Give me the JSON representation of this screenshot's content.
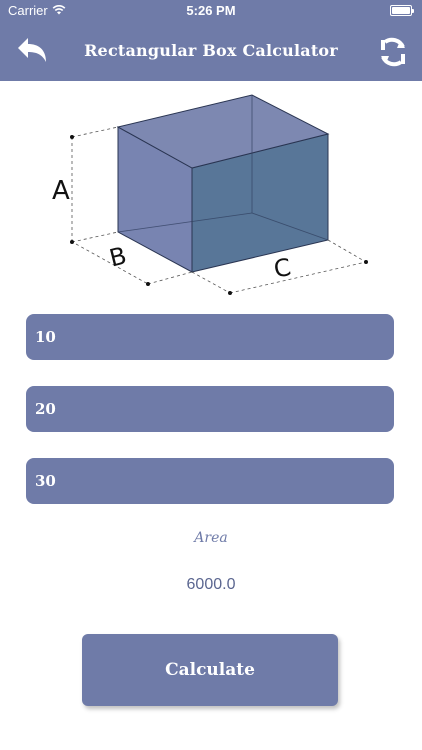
{
  "status": {
    "carrier": "Carrier",
    "time": "5:26 PM"
  },
  "nav": {
    "title": "Rectangular Box Calculator"
  },
  "diagram": {
    "label_a": "A",
    "label_b": "B",
    "label_c": "C"
  },
  "inputs": {
    "a_value": "10",
    "b_value": "20",
    "c_value": "30"
  },
  "result": {
    "label": "Area",
    "value": "6000.0"
  },
  "actions": {
    "calculate_label": "Calculate"
  },
  "colors": {
    "accent": "#6f7ba8",
    "box_front": "#6c79aa",
    "box_side": "#4f6f92"
  }
}
